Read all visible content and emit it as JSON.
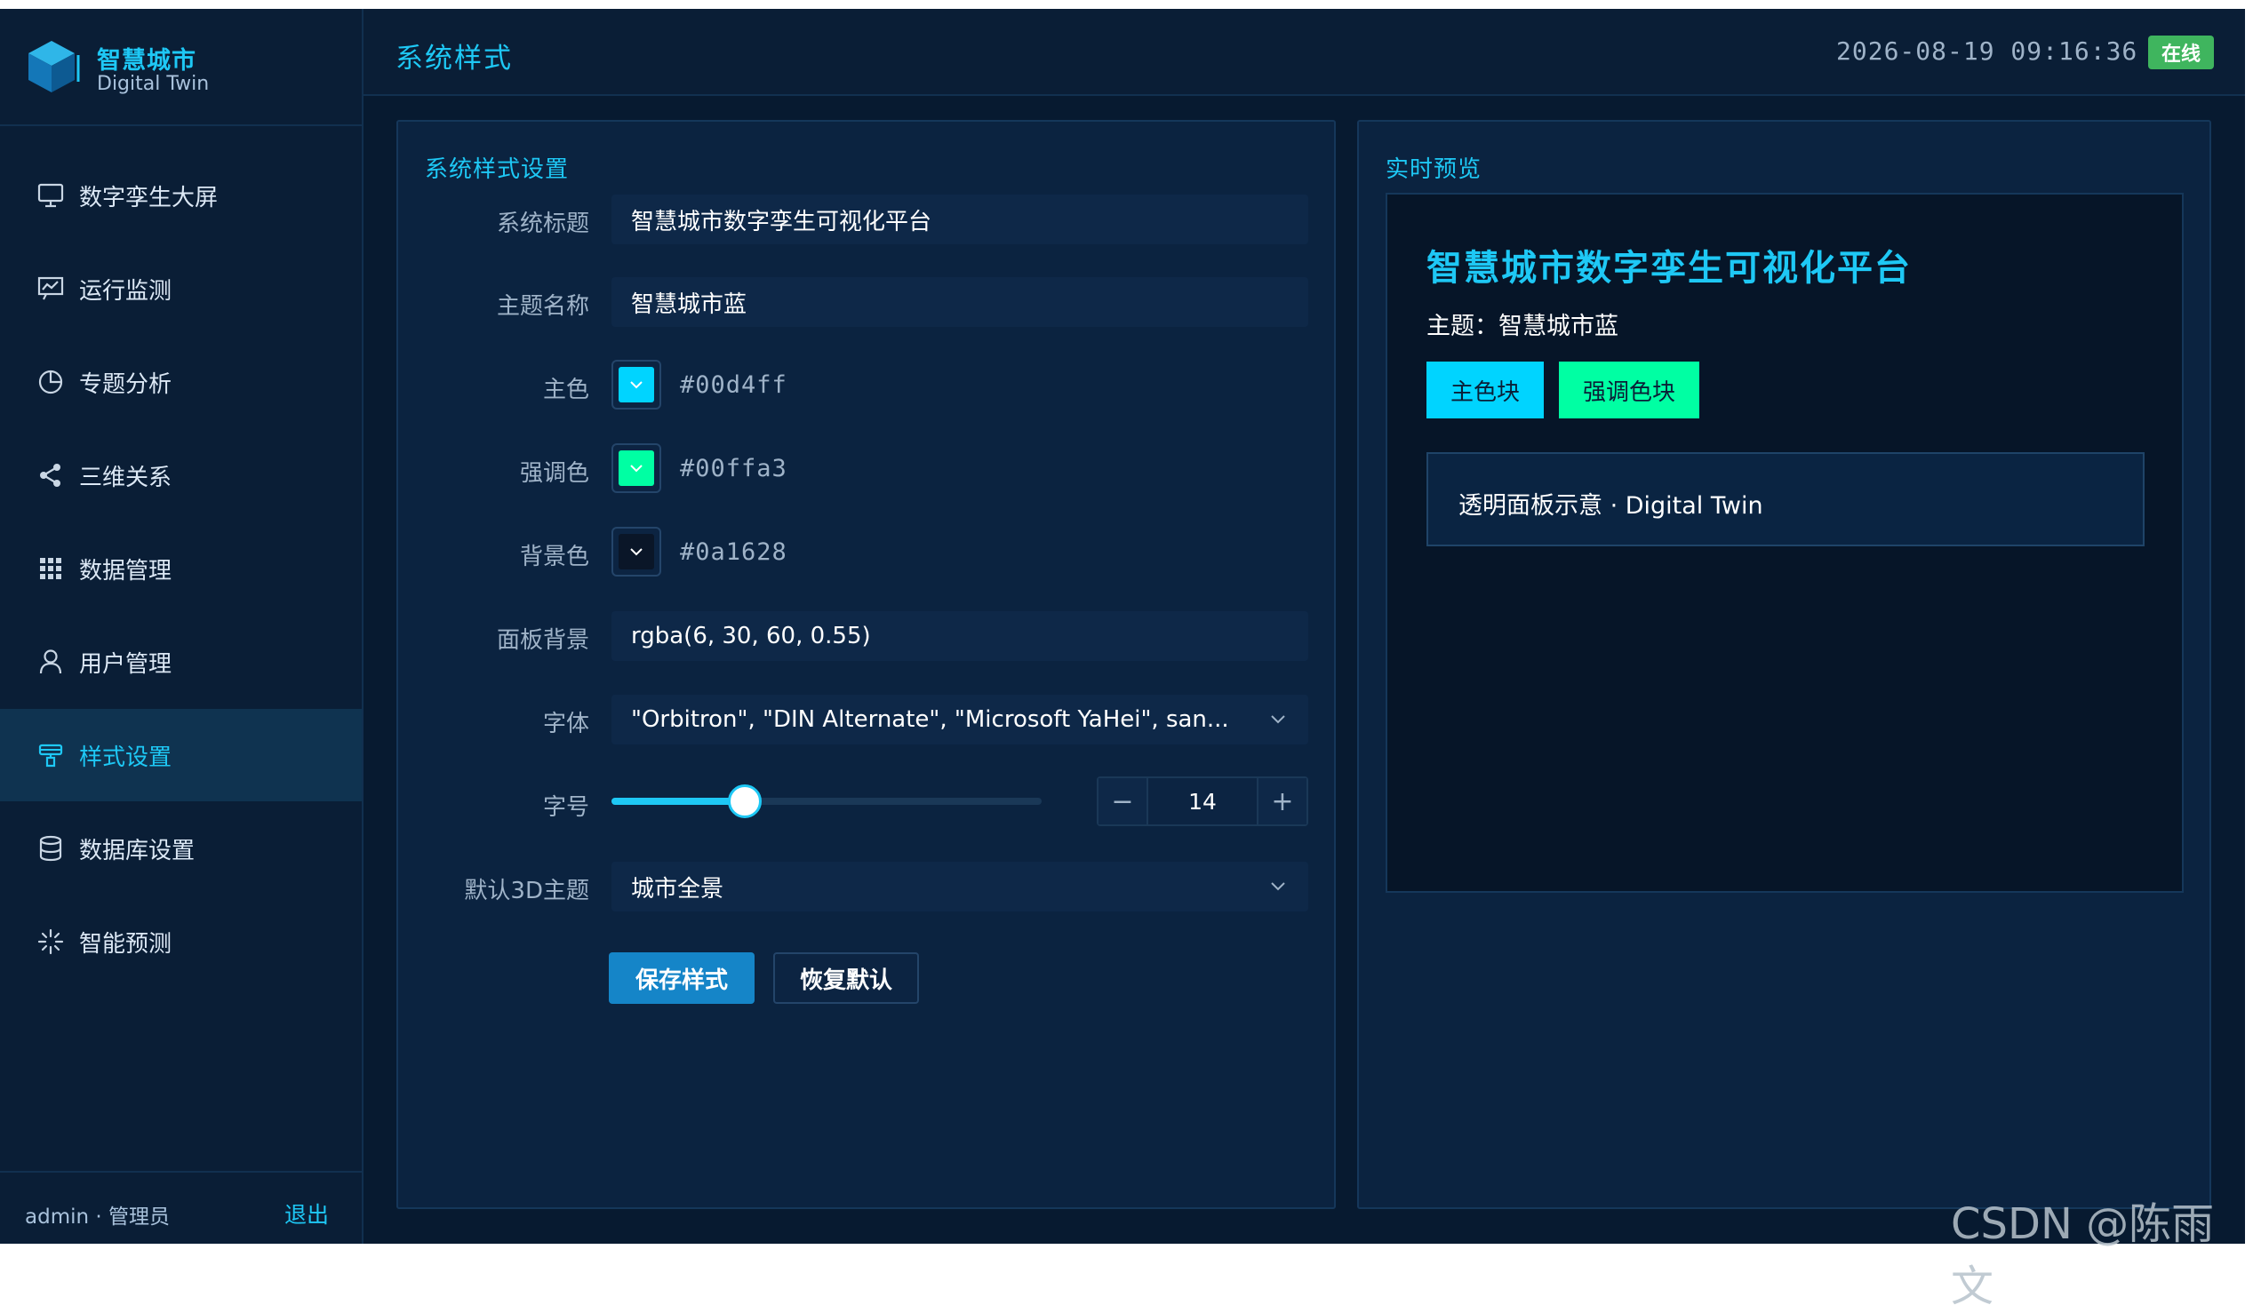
{
  "brand": {
    "title": "智慧城市",
    "subtitle": "Digital Twin"
  },
  "sidebar": {
    "items": [
      {
        "label": "数字孪生大屏",
        "icon": "monitor-icon",
        "active": false
      },
      {
        "label": "运行监测",
        "icon": "line-chart-icon",
        "active": false
      },
      {
        "label": "专题分析",
        "icon": "pie-chart-icon",
        "active": false
      },
      {
        "label": "三维关系",
        "icon": "share-icon",
        "active": false
      },
      {
        "label": "数据管理",
        "icon": "grid-icon",
        "active": false
      },
      {
        "label": "用户管理",
        "icon": "user-icon",
        "active": false
      },
      {
        "label": "样式设置",
        "icon": "brush-icon",
        "active": true
      },
      {
        "label": "数据库设置",
        "icon": "database-icon",
        "active": false
      },
      {
        "label": "智能预测",
        "icon": "sparkle-icon",
        "active": false
      }
    ],
    "user": "admin · 管理员",
    "logout": "退出"
  },
  "header": {
    "title": "系统样式",
    "datetime": "2026-08-19 09:16:36",
    "status": "在线"
  },
  "settings": {
    "panel_title": "系统样式设置",
    "system_title_label": "系统标题",
    "system_title_value": "智慧城市数字孪生可视化平台",
    "theme_name_label": "主题名称",
    "theme_name_value": "智慧城市蓝",
    "primary_label": "主色",
    "primary_value": "#00d4ff",
    "accent_label": "强调色",
    "accent_value": "#00ffa3",
    "bg_label": "背景色",
    "bg_value": "#0a1628",
    "panel_bg_label": "面板背景",
    "panel_bg_value": "rgba(6, 30, 60, 0.55)",
    "font_label": "字体",
    "font_value": "\"Orbitron\", \"DIN Alternate\", \"Microsoft YaHei\", san...",
    "font_size_label": "字号",
    "font_size_value": "14",
    "font_size_slider_fraction": 0.31,
    "minus": "−",
    "plus": "+",
    "default_3d_label": "默认3D主题",
    "default_3d_value": "城市全景",
    "save_button": "保存样式",
    "reset_button": "恢复默认"
  },
  "preview": {
    "panel_title": "实时预览",
    "title": "智慧城市数字孪生可视化平台",
    "theme_line": "主题：智慧城市蓝",
    "primary_block": "主色块",
    "accent_block": "强调色块",
    "panel_text": "透明面板示意 · Digital Twin"
  },
  "colors": {
    "primary": "#00d4ff",
    "accent": "#00ffa3",
    "background": "#0a1628",
    "online": "#3fb55e"
  },
  "watermark": "CSDN @陈雨文"
}
